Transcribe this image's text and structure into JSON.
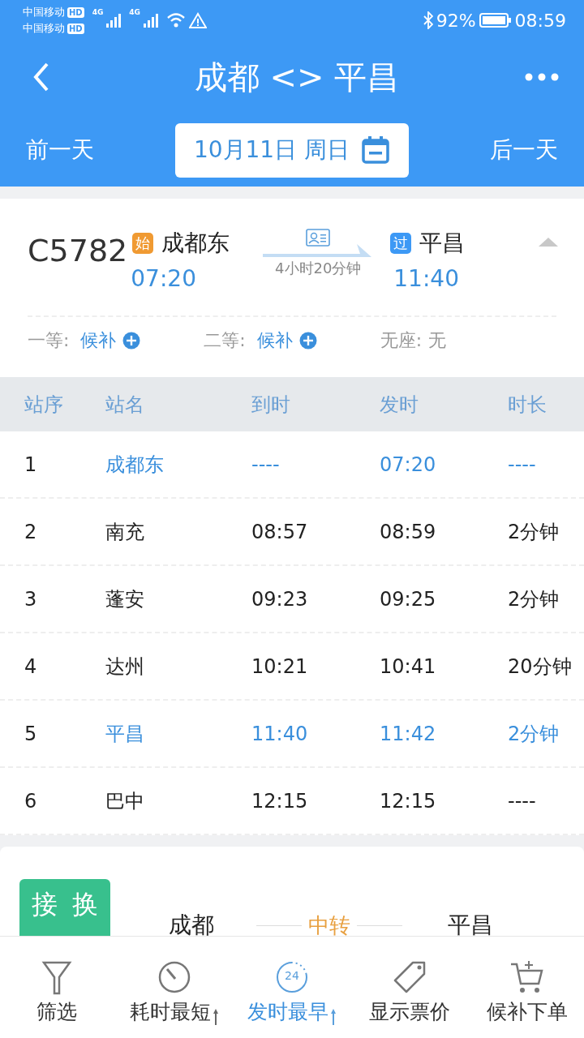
{
  "status_bar": {
    "carrier_1": "中国移动",
    "carrier_2": "中国移动",
    "hd_1": "HD",
    "hd_2": "HD",
    "net_1": "4G",
    "net_2": "4G",
    "battery": "92%",
    "time": "08:59"
  },
  "header": {
    "title": "成都 <> 平昌",
    "prev_day": "前一天",
    "date": "10月11日 周日",
    "next_day": "后一天"
  },
  "train": {
    "number": "C5782",
    "from_badge": "始",
    "from": "成都东",
    "depart": "07:20",
    "duration": "4小时20分钟",
    "to_badge": "过",
    "to": "平昌",
    "arrive": "11:40",
    "expanded": true
  },
  "seats": [
    {
      "label": "一等:",
      "value": "候补",
      "kind": "waitlist"
    },
    {
      "label": "二等:",
      "value": "候补",
      "kind": "waitlist"
    },
    {
      "label": "无座:",
      "value": "无",
      "kind": "plain"
    }
  ],
  "table": {
    "columns": [
      "站序",
      "站名",
      "到时",
      "发时",
      "时长"
    ],
    "rows": [
      {
        "cells": [
          "1",
          "成都东",
          "----",
          "07:20",
          "----"
        ],
        "selected": true
      },
      {
        "cells": [
          "2",
          "南充",
          "08:57",
          "08:59",
          "2分钟"
        ],
        "selected": false
      },
      {
        "cells": [
          "3",
          "蓬安",
          "09:23",
          "09:25",
          "2分钟"
        ],
        "selected": false
      },
      {
        "cells": [
          "4",
          "达州",
          "10:21",
          "10:41",
          "20分钟"
        ],
        "selected": false
      },
      {
        "cells": [
          "5",
          "平昌",
          "11:40",
          "11:42",
          "2分钟"
        ],
        "selected": true
      },
      {
        "cells": [
          "6",
          "巴中",
          "12:15",
          "12:15",
          "----"
        ],
        "selected": false
      }
    ]
  },
  "transfer": {
    "badge": "接 换",
    "from": "成都",
    "via": "中转",
    "to": "平昌"
  },
  "bottom_bar": [
    {
      "label": "筛选",
      "kind": "filter",
      "selected": false,
      "sort": false
    },
    {
      "label": "耗时最短",
      "kind": "timer",
      "selected": false,
      "sort": true
    },
    {
      "label": "发时最早",
      "kind": "clock24",
      "icon_text": "24",
      "selected": true,
      "sort": true
    },
    {
      "label": "显示票价",
      "kind": "tag",
      "selected": false,
      "sort": false
    },
    {
      "label": "候补下单",
      "kind": "cart",
      "selected": false,
      "sort": false
    }
  ]
}
